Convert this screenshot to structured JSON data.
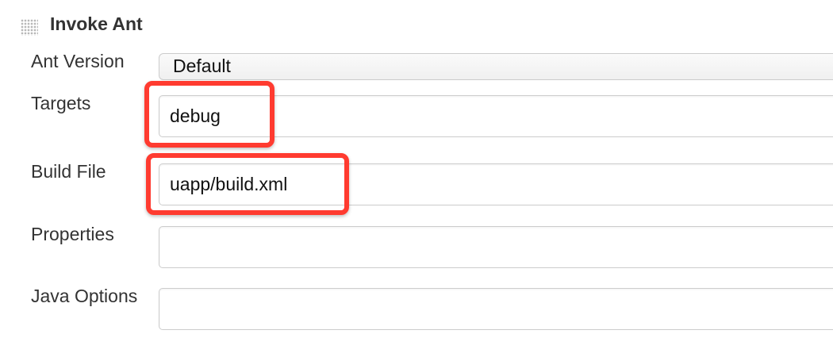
{
  "section": {
    "title": "Invoke Ant",
    "handle_icon": "drag-handle-icon"
  },
  "fields": {
    "ant_version": {
      "label": "Ant Version",
      "value": "Default"
    },
    "targets": {
      "label": "Targets",
      "value": "debug"
    },
    "build_file": {
      "label": "Build File",
      "value": "uapp/build.xml"
    },
    "properties": {
      "label": "Properties",
      "value": ""
    },
    "java_options": {
      "label": "Java Options",
      "value": ""
    }
  },
  "colors": {
    "highlight": "#ff3b30",
    "label": "#333333",
    "input_border": "#cccccc"
  }
}
